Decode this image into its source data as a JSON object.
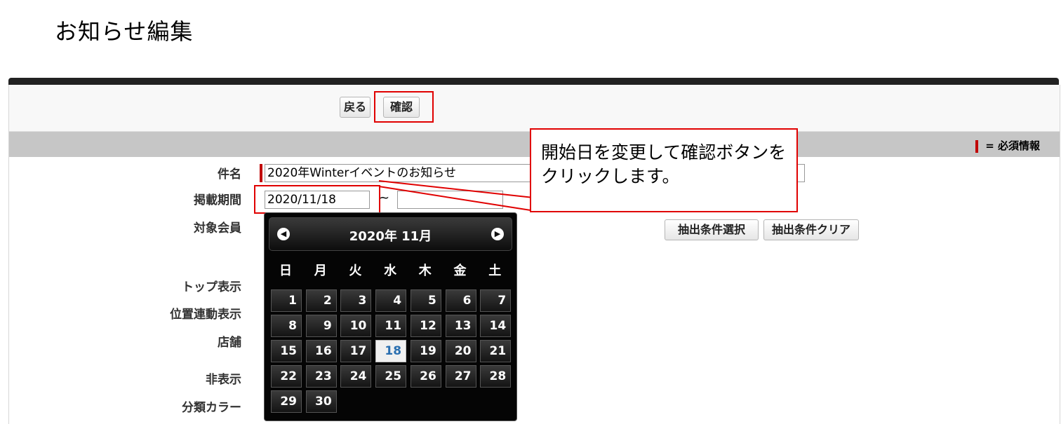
{
  "page": {
    "title": "お知らせ編集"
  },
  "toolbar": {
    "back_label": "戻る",
    "confirm_label": "確認"
  },
  "legend": {
    "required_text": "= 必須情報"
  },
  "form": {
    "subject_label": "件名",
    "subject_value": "2020年Winterイベントのお知らせ",
    "period_label": "掲載期間",
    "period_start": "2020/11/18",
    "period_separator": "~",
    "period_end": "",
    "target_label": "対象会員",
    "top_display_label": "トップ表示",
    "location_display_label": "位置連動表示",
    "store_label": "店舗",
    "hidden_label": "非表示",
    "category_color_label": "分類カラー",
    "extract_select_label": "抽出条件選択",
    "extract_clear_label": "抽出条件クリア"
  },
  "calendar": {
    "title": "2020年 11月",
    "prev_icon": "chevron-left-icon",
    "next_icon": "chevron-right-icon",
    "weekdays": [
      "日",
      "月",
      "火",
      "水",
      "木",
      "金",
      "土"
    ],
    "weeks": [
      [
        "1",
        "2",
        "3",
        "4",
        "5",
        "6",
        "7"
      ],
      [
        "8",
        "9",
        "10",
        "11",
        "12",
        "13",
        "14"
      ],
      [
        "15",
        "16",
        "17",
        "18",
        "19",
        "20",
        "21"
      ],
      [
        "22",
        "23",
        "24",
        "25",
        "26",
        "27",
        "28"
      ],
      [
        "29",
        "30"
      ]
    ],
    "selected_day": "18"
  },
  "callout": {
    "text": "開始日を変更して確認ボタンをクリックします。"
  },
  "colors": {
    "accent_red": "#e00000",
    "header_dark": "#222222",
    "today_blue": "#2a6fb0"
  }
}
